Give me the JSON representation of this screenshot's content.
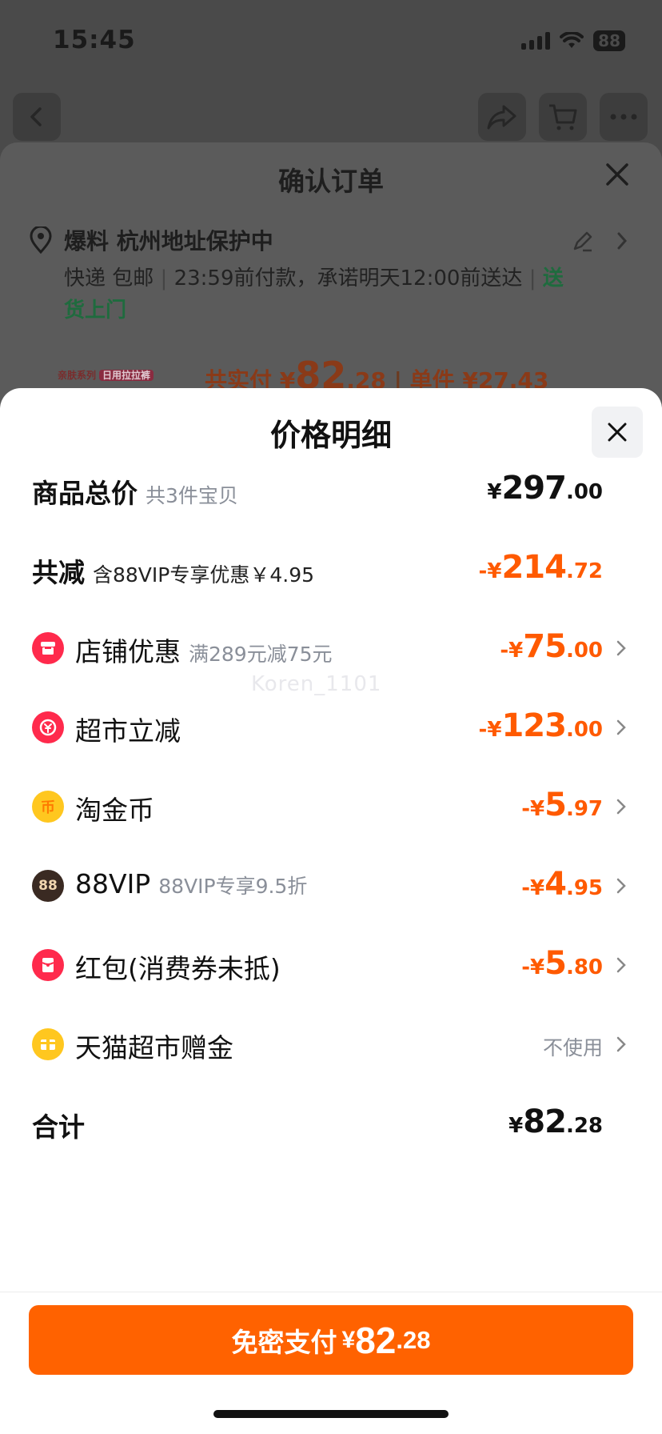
{
  "status_bar": {
    "time": "15:45",
    "battery": "88"
  },
  "background": {
    "title": "确认订单",
    "address_name": "爆料 杭州地址保护中",
    "shipping": "快递 包邮",
    "delivery_note": "23:59前付款，承诺明天12:00前送达",
    "delivery_tag": "送货上门",
    "product_series": "亲肤系列",
    "product_tag": "日用拉拉裤",
    "pay_prefix": "共实付 ¥",
    "pay_int": "82",
    "pay_dec": ".28",
    "unit_price": "单件 ¥27.43"
  },
  "sheet": {
    "title": "价格明细",
    "rows": [
      {
        "label": "商品总价",
        "sub": "共3件宝贝",
        "cur": "¥",
        "int": "297",
        "dec": ".00"
      },
      {
        "label": "共减",
        "sub": "含88VIP专享优惠￥4.95",
        "cur": "-¥",
        "int": "214",
        "dec": ".72"
      },
      {
        "label": "店铺优惠",
        "sub": "满289元减75元",
        "cur": "-¥",
        "int": "75",
        "dec": ".00"
      },
      {
        "label": "超市立减",
        "sub": "",
        "cur": "-¥",
        "int": "123",
        "dec": ".00"
      },
      {
        "label": "淘金币",
        "sub": "",
        "cur": "-¥",
        "int": "5",
        "dec": ".97"
      },
      {
        "label": "88VIP",
        "sub": "88VIP专享9.5折",
        "cur": "-¥",
        "int": "4",
        "dec": ".95"
      },
      {
        "label": "红包(消费券未抵)",
        "sub": "",
        "cur": "-¥",
        "int": "5",
        "dec": ".80"
      },
      {
        "label": "天猫超市赠金",
        "sub": "",
        "value_text": "不使用"
      },
      {
        "label": "合计",
        "sub": "",
        "cur": "¥",
        "int": "82",
        "dec": ".28"
      }
    ],
    "icons": {
      "vip_text": "88",
      "gold_text": "币"
    },
    "watermark": "Koren_1101"
  },
  "pay_button": {
    "label": "免密支付",
    "cur": "¥",
    "int": "82",
    "dec": ".28"
  },
  "colors": {
    "accent": "#ff6200",
    "discount": "#ff5a00"
  }
}
